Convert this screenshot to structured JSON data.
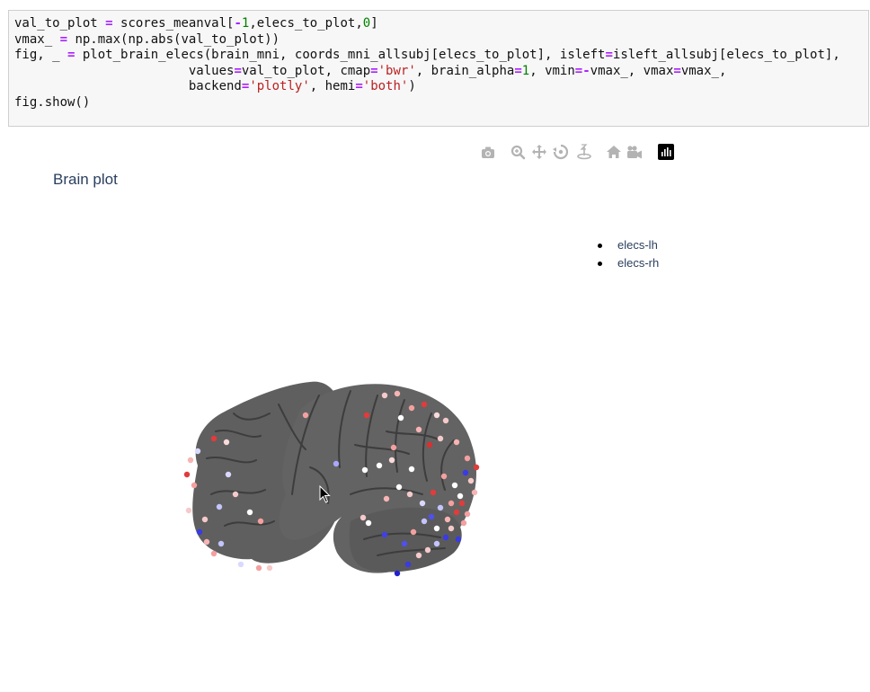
{
  "code_cell": {
    "lines": [
      [
        {
          "t": "val_to_plot ",
          "c": ""
        },
        {
          "t": "=",
          "c": "op"
        },
        {
          "t": " scores_meanval[",
          "c": ""
        },
        {
          "t": "-",
          "c": "op"
        },
        {
          "t": "1",
          "c": "num"
        },
        {
          "t": ",elecs_to_plot,",
          "c": ""
        },
        {
          "t": "0",
          "c": "num"
        },
        {
          "t": "]",
          "c": ""
        }
      ],
      [
        {
          "t": "vmax_ ",
          "c": ""
        },
        {
          "t": "=",
          "c": "op"
        },
        {
          "t": " np.max(np.abs(val_to_plot))",
          "c": ""
        }
      ],
      [
        {
          "t": "fig, _ ",
          "c": ""
        },
        {
          "t": "=",
          "c": "op"
        },
        {
          "t": " plot_brain_elecs(brain_mni, coords_mni_allsubj[elecs_to_plot], isleft",
          "c": ""
        },
        {
          "t": "=",
          "c": "op"
        },
        {
          "t": "isleft_allsubj[elecs_to_plot],",
          "c": ""
        }
      ],
      [
        {
          "t": "                       values",
          "c": ""
        },
        {
          "t": "=",
          "c": "op"
        },
        {
          "t": "val_to_plot, cmap",
          "c": ""
        },
        {
          "t": "=",
          "c": "op"
        },
        {
          "t": "'bwr'",
          "c": "str"
        },
        {
          "t": ", brain_alpha",
          "c": ""
        },
        {
          "t": "=",
          "c": "op"
        },
        {
          "t": "1",
          "c": "num"
        },
        {
          "t": ", vmin",
          "c": ""
        },
        {
          "t": "=-",
          "c": "op"
        },
        {
          "t": "vmax_, vmax",
          "c": ""
        },
        {
          "t": "=",
          "c": "op"
        },
        {
          "t": "vmax_,",
          "c": ""
        }
      ],
      [
        {
          "t": "                       backend",
          "c": ""
        },
        {
          "t": "=",
          "c": "op"
        },
        {
          "t": "'plotly'",
          "c": "str"
        },
        {
          "t": ", hemi",
          "c": ""
        },
        {
          "t": "=",
          "c": "op"
        },
        {
          "t": "'both'",
          "c": "str"
        },
        {
          "t": ")",
          "c": ""
        }
      ],
      [
        {
          "t": "fig.show()",
          "c": ""
        }
      ]
    ]
  },
  "modebar": {
    "buttons": [
      {
        "name": "camera-icon"
      },
      {
        "name": "zoom-icon"
      },
      {
        "name": "pan-icon"
      },
      {
        "name": "orbit-rotation-icon"
      },
      {
        "name": "turntable-rotation-icon"
      },
      {
        "name": "reset-camera-home-icon"
      },
      {
        "name": "save-camera-icon"
      },
      {
        "name": "plotly-logo-icon"
      }
    ],
    "icon_color": "#b3b3b3"
  },
  "plot": {
    "title": "Brain plot",
    "legend": [
      {
        "label": "elecs-lh"
      },
      {
        "label": "elecs-rh"
      }
    ],
    "brain_color": "#5f5f5f",
    "colormap": "bwr"
  }
}
